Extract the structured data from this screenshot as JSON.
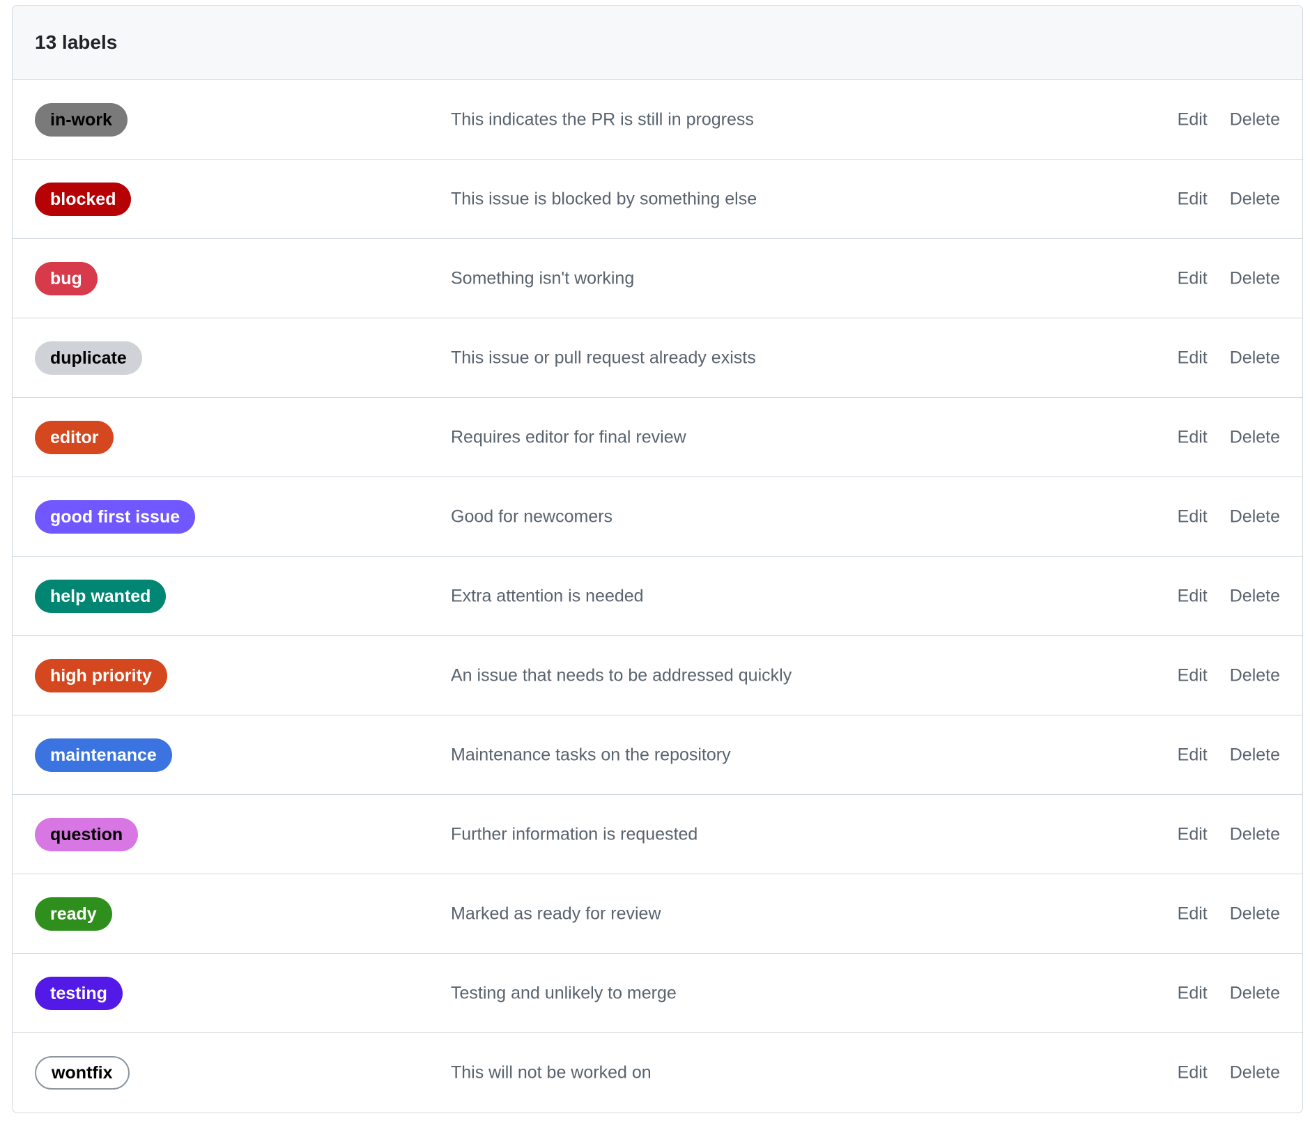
{
  "header": {
    "title": "13 labels"
  },
  "actions": {
    "edit": "Edit",
    "delete": "Delete"
  },
  "labels": [
    {
      "name": "in-work",
      "description": "This indicates the PR is still in progress",
      "bg": "#7a7a7a",
      "fg": "#000000"
    },
    {
      "name": "blocked",
      "description": "This issue is blocked by something else",
      "bg": "#b60205",
      "fg": "#ffffff"
    },
    {
      "name": "bug",
      "description": "Something isn't working",
      "bg": "#d73a4a",
      "fg": "#ffffff"
    },
    {
      "name": "duplicate",
      "description": "This issue or pull request already exists",
      "bg": "#cfd3d7",
      "fg": "#000000"
    },
    {
      "name": "editor",
      "description": "Requires editor for final review",
      "bg": "#d4471f",
      "fg": "#ffffff"
    },
    {
      "name": "good first issue",
      "description": "Good for newcomers",
      "bg": "#7057ff",
      "fg": "#ffffff"
    },
    {
      "name": "help wanted",
      "description": "Extra attention is needed",
      "bg": "#008672",
      "fg": "#ffffff"
    },
    {
      "name": "high priority",
      "description": "An issue that needs to be addressed quickly",
      "bg": "#d4471f",
      "fg": "#ffffff"
    },
    {
      "name": "maintenance",
      "description": "Maintenance tasks on the repository",
      "bg": "#3b74e0",
      "fg": "#ffffff"
    },
    {
      "name": "question",
      "description": "Further information is requested",
      "bg": "#d876e3",
      "fg": "#000000"
    },
    {
      "name": "ready",
      "description": "Marked as ready for review",
      "bg": "#2f8f1c",
      "fg": "#ffffff"
    },
    {
      "name": "testing",
      "description": "Testing and unlikely to merge",
      "bg": "#5319e7",
      "fg": "#ffffff"
    },
    {
      "name": "wontfix",
      "description": "This will not be worked on",
      "bg": "#ffffff",
      "fg": "#000000",
      "border": "#8c959f"
    }
  ]
}
